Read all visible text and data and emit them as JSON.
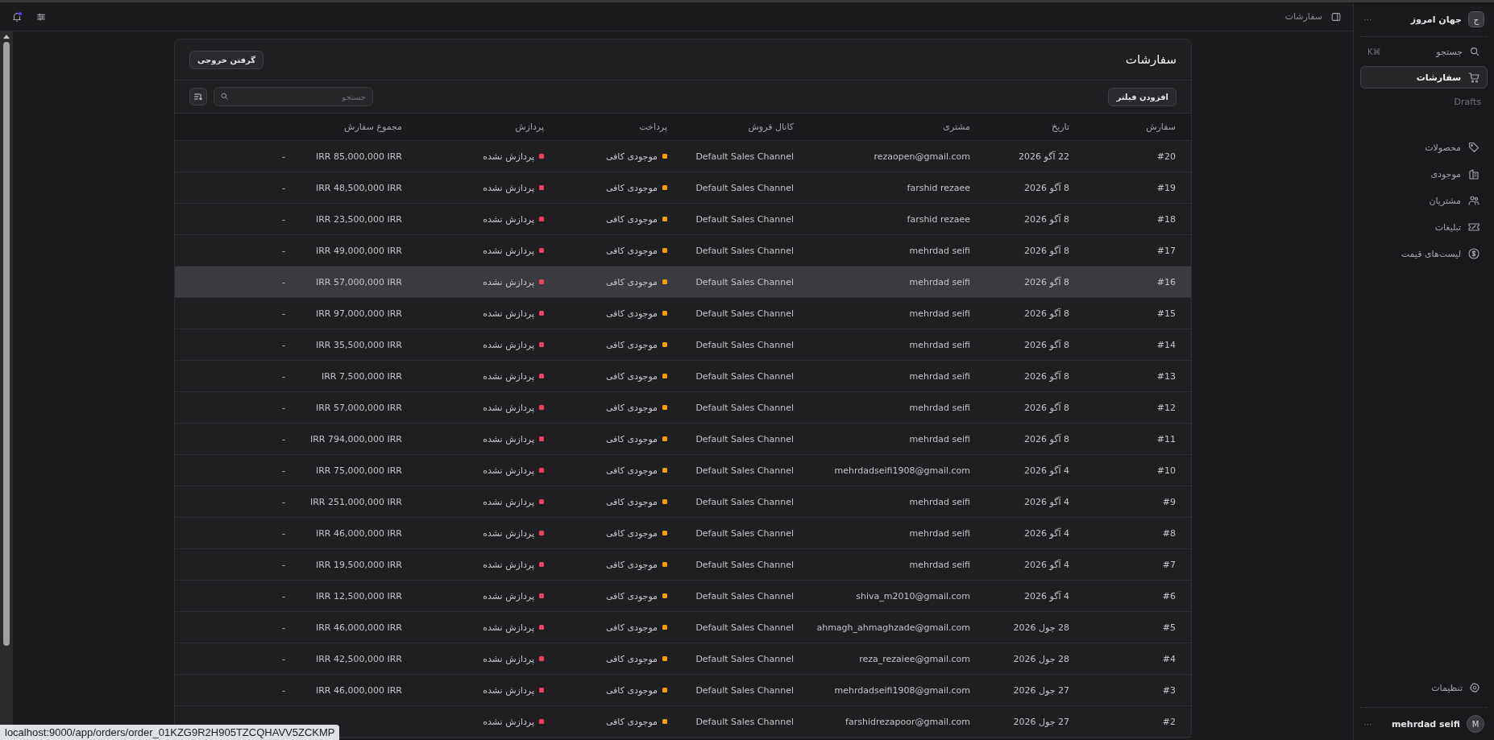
{
  "sidebar": {
    "store": {
      "initial": "ج",
      "name": "جهان امروز",
      "menu": "···"
    },
    "search": {
      "label": "جستجو",
      "shortcut": "⌘K"
    },
    "items": [
      {
        "label": "سفارشات",
        "selected": true,
        "children": [
          {
            "label": "Drafts"
          }
        ]
      },
      {
        "label": "محصولات",
        "selected": false
      },
      {
        "label": "موجودی",
        "selected": false
      },
      {
        "label": "مشتریان",
        "selected": false
      },
      {
        "label": "تبلیغات",
        "selected": false
      },
      {
        "label": "لیست‌های قیمت",
        "selected": false
      }
    ],
    "settings": {
      "label": "تنظیمات"
    },
    "user": {
      "initial": "M",
      "name": "mehrdad seifi",
      "menu": "···"
    }
  },
  "topbar": {
    "breadcrumb": "سفارشات"
  },
  "card": {
    "title": "سفارشات",
    "export_button": "گرفتن خروجی",
    "filter_button": "افزودن فیلتر",
    "search": {
      "placeholder": "جستجو"
    }
  },
  "table": {
    "columns": [
      "سفارش",
      "تاریخ",
      "مشتری",
      "کانال فروش",
      "پرداخت",
      "پردازش",
      "مجموع سفارش"
    ],
    "rows": [
      {
        "order": "#20",
        "date": "22 آگو 2026",
        "customer": "rezaopen@gmail.com",
        "channel": "Default Sales Channel",
        "payment": {
          "label": "موجودی کافی",
          "color": "#f59e0b"
        },
        "processing": {
          "label": "پردازش نشده",
          "color": "#f43f5e"
        },
        "total": "IRR 85,000,000 IRR",
        "column_8": "-",
        "hovered": false
      },
      {
        "order": "#19",
        "date": "8 آگو 2026",
        "customer": "farshid rezaee",
        "channel": "Default Sales Channel",
        "payment": {
          "label": "موجودی کافی",
          "color": "#f59e0b"
        },
        "processing": {
          "label": "پردازش نشده",
          "color": "#f43f5e"
        },
        "total": "IRR 48,500,000 IRR",
        "column_8": "-",
        "hovered": false
      },
      {
        "order": "#18",
        "date": "8 آگو 2026",
        "customer": "farshid rezaee",
        "channel": "Default Sales Channel",
        "payment": {
          "label": "موجودی کافی",
          "color": "#f59e0b"
        },
        "processing": {
          "label": "پردازش نشده",
          "color": "#f43f5e"
        },
        "total": "IRR 23,500,000 IRR",
        "column_8": "-",
        "hovered": false
      },
      {
        "order": "#17",
        "date": "8 آگو 2026",
        "customer": "mehrdad seifi",
        "channel": "Default Sales Channel",
        "payment": {
          "label": "موجودی کافی",
          "color": "#f59e0b"
        },
        "processing": {
          "label": "پردازش نشده",
          "color": "#f43f5e"
        },
        "total": "IRR 49,000,000 IRR",
        "column_8": "-",
        "hovered": false
      },
      {
        "order": "#16",
        "date": "8 آگو 2026",
        "customer": "mehrdad seifi",
        "channel": "Default Sales Channel",
        "payment": {
          "label": "موجودی کافی",
          "color": "#f59e0b"
        },
        "processing": {
          "label": "پردازش نشده",
          "color": "#f43f5e"
        },
        "total": "IRR 57,000,000 IRR",
        "column_8": "-",
        "hovered": true
      },
      {
        "order": "#15",
        "date": "8 آگو 2026",
        "customer": "mehrdad seifi",
        "channel": "Default Sales Channel",
        "payment": {
          "label": "موجودی کافی",
          "color": "#f59e0b"
        },
        "processing": {
          "label": "پردازش نشده",
          "color": "#f43f5e"
        },
        "total": "IRR 97,000,000 IRR",
        "column_8": "-",
        "hovered": false
      },
      {
        "order": "#14",
        "date": "8 آگو 2026",
        "customer": "mehrdad seifi",
        "channel": "Default Sales Channel",
        "payment": {
          "label": "موجودی کافی",
          "color": "#f59e0b"
        },
        "processing": {
          "label": "پردازش نشده",
          "color": "#f43f5e"
        },
        "total": "IRR 35,500,000 IRR",
        "column_8": "-",
        "hovered": false
      },
      {
        "order": "#13",
        "date": "8 آگو 2026",
        "customer": "mehrdad seifi",
        "channel": "Default Sales Channel",
        "payment": {
          "label": "موجودی کافی",
          "color": "#f59e0b"
        },
        "processing": {
          "label": "پردازش نشده",
          "color": "#f43f5e"
        },
        "total": "IRR 7,500,000 IRR",
        "column_8": "-",
        "hovered": false
      },
      {
        "order": "#12",
        "date": "8 آگو 2026",
        "customer": "mehrdad seifi",
        "channel": "Default Sales Channel",
        "payment": {
          "label": "موجودی کافی",
          "color": "#f59e0b"
        },
        "processing": {
          "label": "پردازش نشده",
          "color": "#f43f5e"
        },
        "total": "IRR 57,000,000 IRR",
        "column_8": "-",
        "hovered": false
      },
      {
        "order": "#11",
        "date": "8 آگو 2026",
        "customer": "mehrdad seifi",
        "channel": "Default Sales Channel",
        "payment": {
          "label": "موجودی کافی",
          "color": "#f59e0b"
        },
        "processing": {
          "label": "پردازش نشده",
          "color": "#f43f5e"
        },
        "total": "IRR 794,000,000 IRR",
        "column_8": "-",
        "hovered": false
      },
      {
        "order": "#10",
        "date": "4 آگو 2026",
        "customer": "mehrdadseifi1908@gmail.com",
        "channel": "Default Sales Channel",
        "payment": {
          "label": "موجودی کافی",
          "color": "#f59e0b"
        },
        "processing": {
          "label": "پردازش نشده",
          "color": "#f43f5e"
        },
        "total": "IRR 75,000,000 IRR",
        "column_8": "-",
        "hovered": false
      },
      {
        "order": "#9",
        "date": "4 آگو 2026",
        "customer": "mehrdad seifi",
        "channel": "Default Sales Channel",
        "payment": {
          "label": "موجودی کافی",
          "color": "#f59e0b"
        },
        "processing": {
          "label": "پردازش نشده",
          "color": "#f43f5e"
        },
        "total": "IRR 251,000,000 IRR",
        "column_8": "-",
        "hovered": false
      },
      {
        "order": "#8",
        "date": "4 آگو 2026",
        "customer": "mehrdad seifi",
        "channel": "Default Sales Channel",
        "payment": {
          "label": "موجودی کافی",
          "color": "#f59e0b"
        },
        "processing": {
          "label": "پردازش نشده",
          "color": "#f43f5e"
        },
        "total": "IRR 46,000,000 IRR",
        "column_8": "-",
        "hovered": false
      },
      {
        "order": "#7",
        "date": "4 آگو 2026",
        "customer": "mehrdad seifi",
        "channel": "Default Sales Channel",
        "payment": {
          "label": "موجودی کافی",
          "color": "#f59e0b"
        },
        "processing": {
          "label": "پردازش نشده",
          "color": "#f43f5e"
        },
        "total": "IRR 19,500,000 IRR",
        "column_8": "-",
        "hovered": false
      },
      {
        "order": "#6",
        "date": "4 آگو 2026",
        "customer": "shiva_m2010@gmail.com",
        "channel": "Default Sales Channel",
        "payment": {
          "label": "موجودی کافی",
          "color": "#f59e0b"
        },
        "processing": {
          "label": "پردازش نشده",
          "color": "#f43f5e"
        },
        "total": "IRR 12,500,000 IRR",
        "column_8": "-",
        "hovered": false
      },
      {
        "order": "#5",
        "date": "28 جول 2026",
        "customer": "ahmagh_ahmaghzade@gmail.com",
        "channel": "Default Sales Channel",
        "payment": {
          "label": "موجودی کافی",
          "color": "#f59e0b"
        },
        "processing": {
          "label": "پردازش نشده",
          "color": "#f43f5e"
        },
        "total": "IRR 46,000,000 IRR",
        "column_8": "-",
        "hovered": false
      },
      {
        "order": "#4",
        "date": "28 جول 2026",
        "customer": "reza_rezaiee@gmail.com",
        "channel": "Default Sales Channel",
        "payment": {
          "label": "موجودی کافی",
          "color": "#f59e0b"
        },
        "processing": {
          "label": "پردازش نشده",
          "color": "#f43f5e"
        },
        "total": "IRR 42,500,000 IRR",
        "column_8": "-",
        "hovered": false
      },
      {
        "order": "#3",
        "date": "27 جول 2026",
        "customer": "mehrdadseifi1908@gmail.com",
        "channel": "Default Sales Channel",
        "payment": {
          "label": "موجودی کافی",
          "color": "#f59e0b"
        },
        "processing": {
          "label": "پردازش نشده",
          "color": "#f43f5e"
        },
        "total": "IRR 46,000,000 IRR",
        "column_8": "-",
        "hovered": false
      },
      {
        "order": "#2",
        "date": "27 جول 2026",
        "customer": "farshidrezapoor@gmail.com",
        "channel": "Default Sales Channel",
        "payment": {
          "label": "موجودی کافی",
          "color": "#f59e0b"
        },
        "processing": {
          "label": "پردازش نشده",
          "color": "#f43f5e"
        },
        "hovered": false
      }
    ]
  },
  "status_url": "localhost:9000/app/orders/order_01KZG9R2H905TZCQHAVV5ZCKMP"
}
